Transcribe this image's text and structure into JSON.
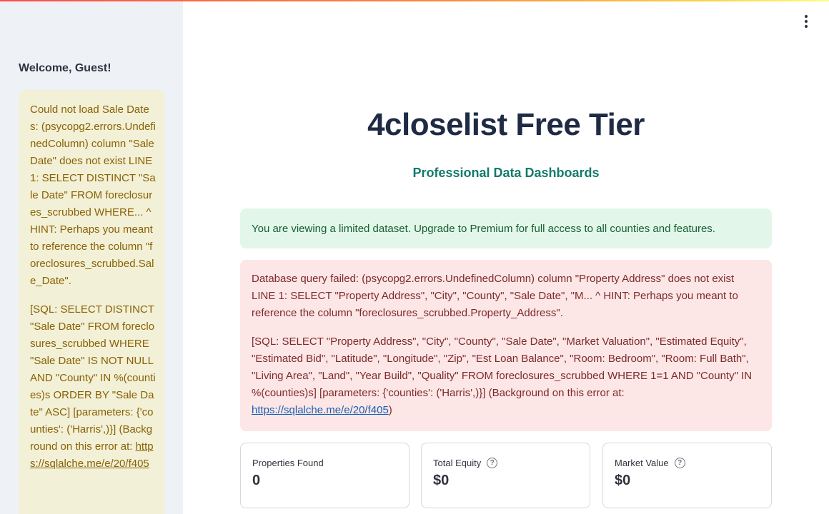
{
  "sidebar": {
    "welcome": "Welcome, Guest!",
    "warning_text_1": "Could not load Sale Dates: (psycopg2.errors.UndefinedColumn) column \"Sale Date\" does not exist LINE 1: SELECT DISTINCT \"Sale Date\" FROM foreclosures_scrubbed WHERE... ^ HINT: Perhaps you meant to reference the column \"foreclosures_scrubbed.Sale_Date\".",
    "warning_text_2": "[SQL: SELECT DISTINCT \"Sale Date\" FROM foreclosures_scrubbed WHERE \"Sale Date\" IS NOT NULL AND \"County\" IN %(counties)s ORDER BY \"Sale Date\" ASC] [parameters: {'counties': ('Harris',)}] (Background on this error at: ",
    "warning_link": "https://sqlalche.me/e/20/f405"
  },
  "header": {
    "menu_icon": "vertical-ellipsis-icon"
  },
  "main": {
    "title": "4closelist Free Tier",
    "subtitle": "Professional Data Dashboards",
    "info_message": "You are viewing a limited dataset. Upgrade to Premium for full access to all counties and features.",
    "error_text_1": "Database query failed: (psycopg2.errors.UndefinedColumn) column \"Property Address\" does not exist LINE 1: SELECT \"Property Address\", \"City\", \"County\", \"Sale Date\", \"M... ^ HINT: Perhaps you meant to reference the column \"foreclosures_scrubbed.Property_Address\".",
    "error_text_2": "[SQL: SELECT \"Property Address\", \"City\", \"County\", \"Sale Date\", \"Market Valuation\", \"Estimated Equity\", \"Estimated Bid\", \"Latitude\", \"Longitude\", \"Zip\", \"Est Loan Balance\", \"Room: Bedroom\", \"Room: Full Bath\", \"Living Area\", \"Land\", \"Year Build\", \"Quality\" FROM foreclosures_scrubbed WHERE 1=1 AND \"County\" IN %(counties)s] [parameters: {'counties': ('Harris',)}] (Background on this error at: ",
    "error_link": "https://sqlalche.me/e/20/f405",
    "error_suffix": ")",
    "metrics": [
      {
        "label": "Properties Found",
        "value": "0"
      },
      {
        "label": "Total Equity",
        "value": "$0"
      },
      {
        "label": "Market Value",
        "value": "$0"
      }
    ]
  },
  "colors": {
    "accent_gradient": [
      "#ff4b4b",
      "#ffd23f"
    ],
    "subtitle": "#137a6d",
    "success_bg": "#e3f6ea",
    "error_bg": "#fde6e6",
    "warning_bg": "#f2f0d6"
  }
}
